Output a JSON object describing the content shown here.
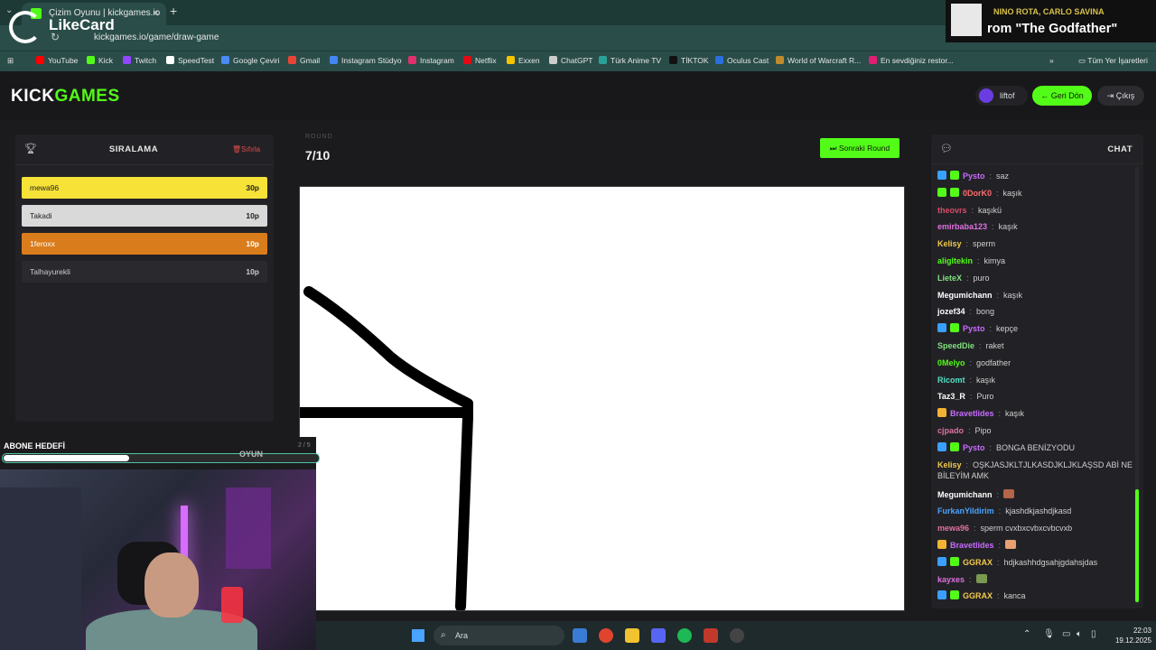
{
  "browser": {
    "tab_title": "Çizim Oyunu | kickgames.io",
    "url": "kickgames.io/game/draw-game",
    "bookmarks": [
      {
        "label": "YouTube",
        "color": "#ff0000"
      },
      {
        "label": "Kick",
        "color": "#53fc18"
      },
      {
        "label": "Twitch",
        "color": "#9146ff"
      },
      {
        "label": "SpeedTest",
        "color": "#ffffff"
      },
      {
        "label": "Google Çeviri",
        "color": "#4a8af4"
      },
      {
        "label": "Gmail",
        "color": "#ea4335"
      },
      {
        "label": "Instagram Stüdyo",
        "color": "#4285f4"
      },
      {
        "label": "Instagram",
        "color": "#e1306c"
      },
      {
        "label": "Netflix",
        "color": "#e50914"
      },
      {
        "label": "Exxen",
        "color": "#f5c400"
      },
      {
        "label": "ChatGPT",
        "color": "#cccccc"
      },
      {
        "label": "Türk Anime TV",
        "color": "#2aa198"
      },
      {
        "label": "TİKTOK",
        "color": "#111111"
      },
      {
        "label": "Oculus Cast",
        "color": "#2a6fdb"
      },
      {
        "label": "World of Warcraft R...",
        "color": "#c08a2a"
      },
      {
        "label": "En sevdiğiniz restor...",
        "color": "#e11d74"
      }
    ],
    "all_bookmarks": "Tüm Yer İşaretleri"
  },
  "overlay": {
    "likecard": "LikeCard",
    "np_artist": "NINO ROTA, CARLO SAVINA",
    "np_title": "rom \"The Godfather\""
  },
  "site": {
    "logo_a": "KICK",
    "logo_b": "GAMES",
    "username": "liftof",
    "back_label": "Geri Dön",
    "exit_label": "Çıkış"
  },
  "ranking": {
    "title": "SIRALAMA",
    "reset": "Sıfırla",
    "players": [
      {
        "name": "mewa96",
        "points": "30p",
        "bg": "#f7e238",
        "fg": "#222"
      },
      {
        "name": "Takadi",
        "points": "10p",
        "bg": "#d9d9d9",
        "fg": "#222"
      },
      {
        "name": "1feroxx",
        "points": "10p",
        "bg": "#d97c1b",
        "fg": "#fff"
      },
      {
        "name": "Talhayurekli",
        "points": "10p",
        "bg": "#2a2a2e",
        "fg": "#ccc"
      }
    ]
  },
  "game": {
    "round_label": "ROUND",
    "round_value": "7/10",
    "next_round": "Sonraki Round"
  },
  "chat": {
    "title": "CHAT",
    "messages": [
      {
        "user": "Pysto",
        "color": "#c86bff",
        "text": "saz",
        "badges": [
          "#3aa0ff",
          "#53fc18"
        ]
      },
      {
        "user": "0DorK0",
        "color": "#ff6b6b",
        "text": "kaşık",
        "badges": [
          "#53fc18",
          "#53fc18"
        ]
      },
      {
        "user": "theovrs",
        "color": "#d94c6a",
        "text": "kaşıkü",
        "badges": []
      },
      {
        "user": "emirbaba123",
        "color": "#e070e0",
        "text": "kaşık",
        "badges": []
      },
      {
        "user": "Kelisy",
        "color": "#f2c94c",
        "text": "sperm",
        "badges": []
      },
      {
        "user": "aligltekin",
        "color": "#53fc18",
        "text": "kimya",
        "badges": []
      },
      {
        "user": "LieteX",
        "color": "#7fe07f",
        "text": "puro",
        "badges": []
      },
      {
        "user": "Megumichann",
        "color": "#ffffff",
        "text": "kaşık",
        "badges": []
      },
      {
        "user": "jozef34",
        "color": "#ffffff",
        "text": "bong",
        "badges": []
      },
      {
        "user": "Pysto",
        "color": "#c86bff",
        "text": "kepçe",
        "badges": [
          "#3aa0ff",
          "#53fc18"
        ]
      },
      {
        "user": "SpeedDie",
        "color": "#7fe07f",
        "text": "raket",
        "badges": []
      },
      {
        "user": "0Melyo",
        "color": "#53fc18",
        "text": "godfather",
        "badges": []
      },
      {
        "user": "Ricomt",
        "color": "#53e0c4",
        "text": "kaşık",
        "badges": []
      },
      {
        "user": "Taz3_R",
        "color": "#ffffff",
        "text": "Puro",
        "badges": []
      },
      {
        "user": "Bravetlides",
        "color": "#c86bff",
        "text": "kaşık",
        "badges": [
          "#f2b233"
        ]
      },
      {
        "user": "cjpado",
        "color": "#e070a0",
        "text": "Pipo",
        "badges": []
      },
      {
        "user": "Pysto",
        "color": "#c86bff",
        "text": "BONGA BENİZYODU",
        "badges": [
          "#3aa0ff",
          "#53fc18"
        ]
      },
      {
        "user": "Kelisy",
        "color": "#f2c94c",
        "text": "OŞKJASJKLTJLKASDJKLJKLAŞSD ABİ NE BİLEYİM AMK",
        "badges": []
      },
      {
        "user": "Megumichann",
        "color": "#ffffff",
        "text": "",
        "badges": [],
        "emote": "#b5654a"
      },
      {
        "user": "FurkanYildirim",
        "color": "#4aa3ff",
        "text": "kjashdkjashdjkasd",
        "badges": []
      },
      {
        "user": "mewa96",
        "color": "#e070a0",
        "text": "sperm cvxbxcvbxcvbcvxb",
        "badges": []
      },
      {
        "user": "Bravetlides",
        "color": "#c86bff",
        "text": "",
        "badges": [
          "#f2b233"
        ],
        "emote": "#e8a070"
      },
      {
        "user": "GGRAX",
        "color": "#f2c94c",
        "text": "hdjkashhdgsahjgdahsjdas",
        "badges": [
          "#3aa0ff",
          "#53fc18"
        ]
      },
      {
        "user": "kayxes",
        "color": "#e070e0",
        "text": "",
        "badges": [],
        "emote": "#7a9a50"
      },
      {
        "user": "GGRAX",
        "color": "#f2c94c",
        "text": "kanca",
        "badges": [
          "#3aa0ff",
          "#53fc18"
        ]
      }
    ]
  },
  "stream": {
    "goal_title": "ABONE HEDEFİ",
    "goal_progress": 0.4,
    "goal_label": "OYUN",
    "goal_count": "2 / 5"
  },
  "taskbar": {
    "search": "Ara",
    "time": "22:03",
    "date": "19.12.2025"
  }
}
